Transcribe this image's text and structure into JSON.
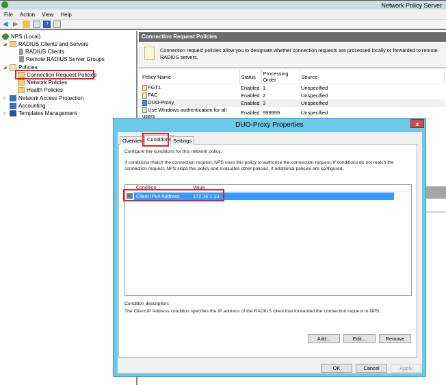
{
  "window": {
    "title": "Network Policy Server"
  },
  "menu": [
    "File",
    "Action",
    "View",
    "Help"
  ],
  "tree": {
    "root": "NPS (Local)",
    "radius": "RADIUS Clients and Servers",
    "radius_clients": "RADIUS Clients",
    "remote_groups": "Remote RADIUS Server Groups",
    "policies": "Policies",
    "crp": "Connection Request Policies",
    "network_policies": "Network Policies",
    "health_policies": "Health Policies",
    "nap": "Network Access Protection",
    "accounting": "Accounting",
    "templates": "Templates Management"
  },
  "right": {
    "header": "Connection Request Policies",
    "description": "Connection request policies allow you to designate whether connection requests are processed locally or forwarded to remote RADIUS servers.",
    "columns": [
      "Policy Name",
      "Status",
      "Processing Order",
      "Source"
    ],
    "rows": [
      {
        "name": "FGT1",
        "status": "Enabled",
        "order": "1",
        "source": "Unspecified"
      },
      {
        "name": "FAC",
        "status": "Enabled",
        "order": "2",
        "source": "Unspecified"
      },
      {
        "name": "DUO-Proxy",
        "status": "Enabled",
        "order": "3",
        "source": "Unspecified"
      },
      {
        "name": "Use Windows authentication for all users",
        "status": "Enabled",
        "order": "999999",
        "source": "Unspecified"
      }
    ]
  },
  "dialog": {
    "title": "DUO-Proxy Properties",
    "close": "x",
    "tabs": [
      "Overview",
      "Conditions",
      "Settings"
    ],
    "intro": "Configure the conditions for this network policy.",
    "info1": "If conditions match the connection request, NPS uses this policy to authorize the connection request. If conditions do not match the",
    "info2": "connection request, NPS skips this policy and evaluates other policies, if additional policies are configured.",
    "columns": [
      "Condition",
      "Value"
    ],
    "condition": {
      "name": "Client IPv4 Address",
      "value": "172.16.1.13"
    },
    "desc_label": "Condition description:",
    "desc_text": "The Client IP Address condition specifies the IP address of the RADIUS client that forwarded the connection request to NPS.",
    "add": "Add...",
    "edit": "Edit...",
    "remove": "Remove",
    "ok": "OK",
    "cancel": "Cancel",
    "apply": "Apply"
  },
  "colors": {
    "dialog_frame": "#6cc9ea",
    "selection": "#3399ff",
    "highlight": "#e0202a"
  }
}
